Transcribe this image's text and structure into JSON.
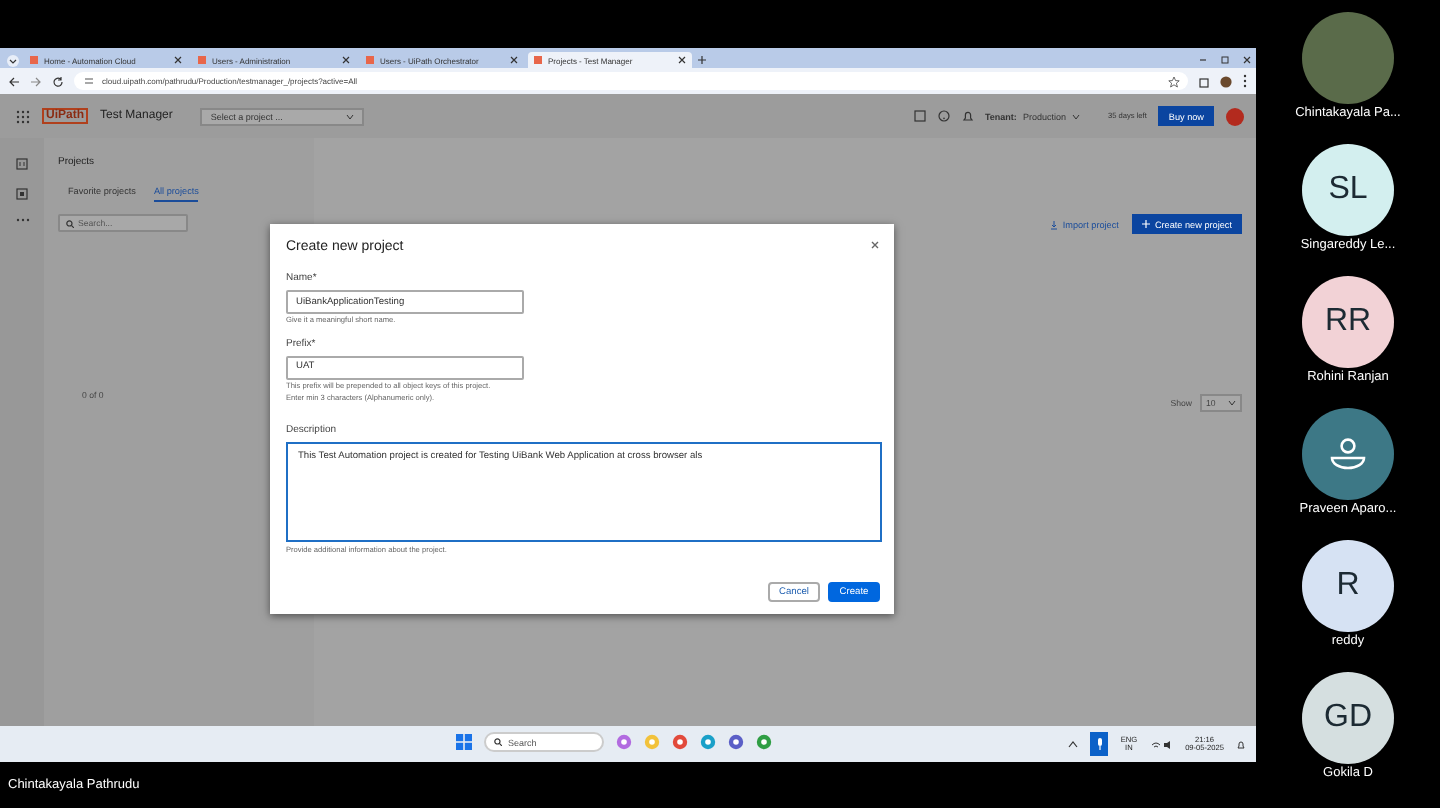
{
  "browser": {
    "tabs": [
      {
        "label": "Home - Automation Cloud",
        "selected": false
      },
      {
        "label": "Users - Administration",
        "selected": false
      },
      {
        "label": "Users - UiPath Orchestrator",
        "selected": false
      },
      {
        "label": "Projects - Test Manager",
        "selected": true
      }
    ],
    "url": "cloud.uipath.com/pathrudu/Production/testmanager_/projects?active=All"
  },
  "app": {
    "logo": "UiPath",
    "product": "Test Manager",
    "project_select": "Select a project ...",
    "tenant_label": "Tenant:",
    "tenant": "Production",
    "trial": "35 days left",
    "buy": "Buy now"
  },
  "projects": {
    "heading": "Projects",
    "tabs": [
      {
        "label": "Favorite projects",
        "selected": false
      },
      {
        "label": "All projects",
        "selected": true
      }
    ],
    "search_placeholder": "Search...",
    "import": "Import project",
    "create": "Create new project",
    "count": "0 of 0",
    "show_label": "Show",
    "page_size": "10"
  },
  "dialog": {
    "title": "Create new project",
    "fields": [
      {
        "kind": "input",
        "label": "Name*",
        "value": "UiBankApplicationTesting",
        "focused": false,
        "hints": [
          "Give it a meaningful short name."
        ]
      },
      {
        "kind": "input",
        "label": "Prefix*",
        "value": "UAT",
        "focused": false,
        "hints": [
          "This prefix will be prepended to all object keys of this project.",
          "Enter min 3 characters (Alphanumeric only)."
        ]
      },
      {
        "kind": "textarea",
        "label": "Description",
        "value": "This Test Automation project is created for Testing UiBank Web Application at cross browser als",
        "focused": true,
        "hints": [
          "Provide additional information about the project."
        ]
      }
    ],
    "buttons": [
      {
        "label": "Cancel",
        "primary": false
      },
      {
        "label": "Create",
        "primary": true
      }
    ]
  },
  "taskbar": {
    "search_placeholder": "Search",
    "language": "ENG",
    "region": "IN",
    "time": "21:16",
    "date": "09-05-2025"
  },
  "participants": [
    {
      "kind": "photo",
      "name": "Chintakayala Pa..."
    },
    {
      "kind": "initials",
      "initials": "SL",
      "name": "Singareddy  Le...",
      "color": "#d3efef"
    },
    {
      "kind": "initials",
      "initials": "RR",
      "name": "Rohini  Ranjan",
      "color": "#f2d2d6"
    },
    {
      "kind": "icon",
      "name": "Praveen  Aparo...",
      "color": "#3d7886"
    },
    {
      "kind": "initials",
      "initials": "R",
      "name": "reddy",
      "color": "#d6e2f3"
    },
    {
      "kind": "initials",
      "initials": "GD",
      "name": "Gokila  D",
      "color": "#d5dfe0"
    }
  ],
  "presenter": "Chintakayala Pathrudu"
}
